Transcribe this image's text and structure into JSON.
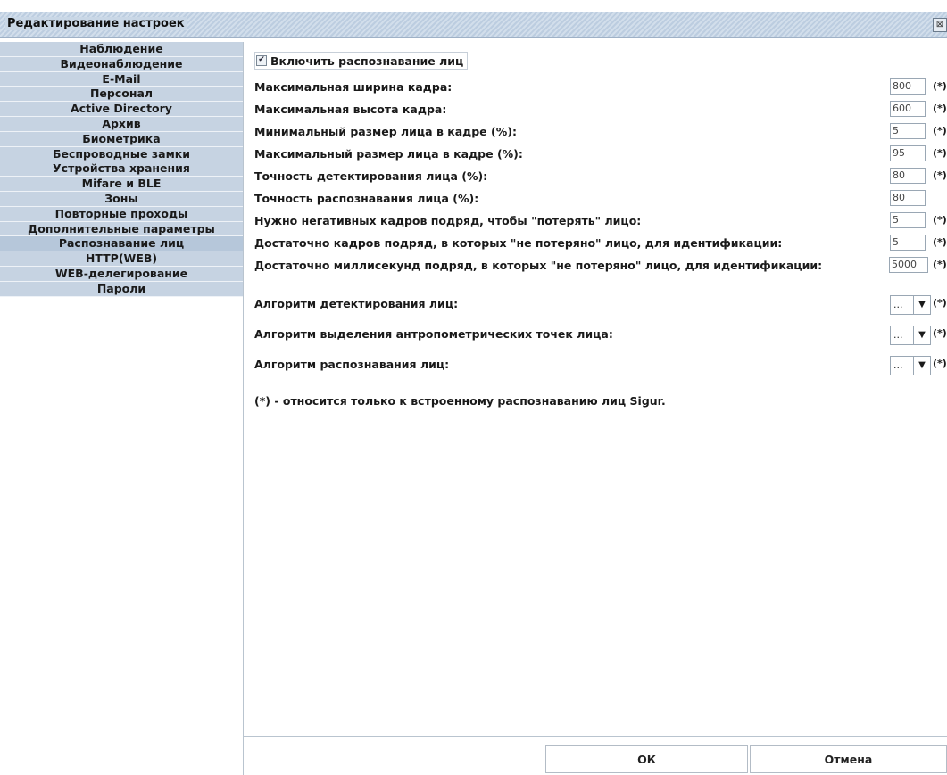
{
  "window": {
    "title": "Редактирование настроек",
    "close_glyph": "⊠"
  },
  "sidebar": {
    "items": [
      {
        "label": "Наблюдение"
      },
      {
        "label": "Видеонаблюдение"
      },
      {
        "label": "E-Mail"
      },
      {
        "label": "Персонал"
      },
      {
        "label": "Active Directory"
      },
      {
        "label": "Архив"
      },
      {
        "label": "Биометрика"
      },
      {
        "label": "Беспроводные замки"
      },
      {
        "label": "Устройства хранения"
      },
      {
        "label": "Mifare и BLE"
      },
      {
        "label": "Зоны"
      },
      {
        "label": "Повторные проходы"
      },
      {
        "label": "Дополнительные параметры"
      },
      {
        "label": "Распознавание лиц"
      },
      {
        "label": "HTTP(WEB)"
      },
      {
        "label": "WEB-делегирование"
      },
      {
        "label": "Пароли"
      }
    ],
    "active_index": 13
  },
  "content": {
    "enable_checkbox": {
      "label": "Включить распознавание лиц",
      "checked": true,
      "glyph": "✔"
    },
    "asterisk": "(*)",
    "fields": [
      {
        "label": "Максимальная ширина кадра:",
        "value": "800",
        "asterisk": true
      },
      {
        "label": "Максимальная высота кадра:",
        "value": "600",
        "asterisk": true
      },
      {
        "label": "Минимальный размер лица в кадре (%):",
        "value": "5",
        "asterisk": true
      },
      {
        "label": "Максимальный размер лица в кадре (%):",
        "value": "95",
        "asterisk": true
      },
      {
        "label": "Точность детектирования лица (%):",
        "value": "80",
        "asterisk": true
      },
      {
        "label": "Точность распознавания лица (%):",
        "value": "80",
        "asterisk": false
      },
      {
        "label": "Нужно негативных кадров подряд, чтобы \"потерять\" лицо:",
        "value": "5",
        "asterisk": true
      },
      {
        "label": "Достаточно кадров подряд, в которых \"не потеряно\" лицо, для идентификации:",
        "value": "5",
        "asterisk": true
      },
      {
        "label": "Достаточно миллисекунд подряд, в которых \"не потеряно\" лицо, для идентификации:",
        "value": "5000",
        "asterisk": true
      }
    ],
    "combos": [
      {
        "label": "Алгоритм детектирования лиц:",
        "value": "...",
        "arrow": "▼"
      },
      {
        "label": "Алгоритм выделения антропометрических точек лица:",
        "value": "...",
        "arrow": "▼"
      },
      {
        "label": "Алгоритм распознавания лиц:",
        "value": "...",
        "arrow": "▼"
      }
    ],
    "note": "(*) - относится только к встроенному распознаванию лиц Sigur."
  },
  "buttons": {
    "ok": "ОК",
    "cancel": "Отмена"
  }
}
